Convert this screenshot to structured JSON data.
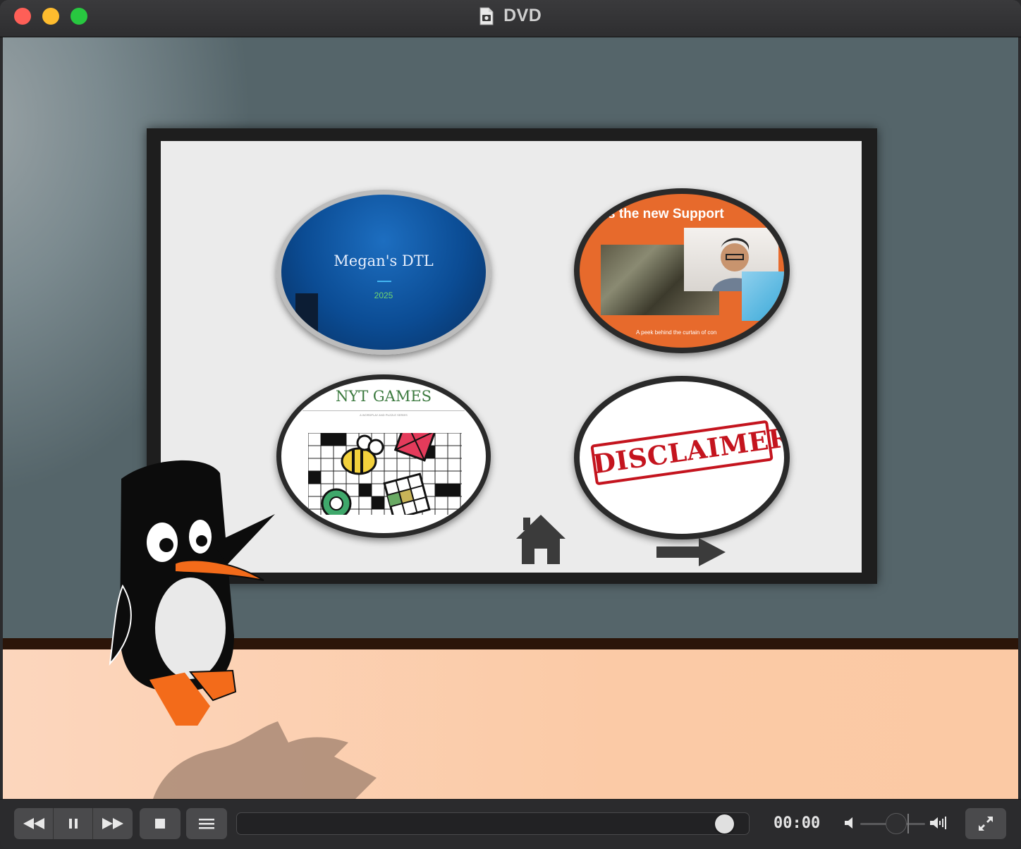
{
  "window": {
    "title": "DVD"
  },
  "menu": {
    "items": [
      {
        "label": "Megan's DTL",
        "year": "2025"
      },
      {
        "heading": "s the new Support",
        "caption": "A peek behind the curtain of con"
      },
      {
        "title": "NYT GAMES",
        "subtitle": "A WORDPLAY AND PUZZLE SERIES"
      },
      {
        "stamp": "DISCLAIMER"
      }
    ]
  },
  "controls": {
    "time": "00:00",
    "progress_fraction": 0.95,
    "volume_fraction": 0.55
  },
  "icons": {
    "rewind": "rewind-icon",
    "pause": "pause-icon",
    "fast_forward": "fast-forward-icon",
    "stop": "stop-icon",
    "playlist": "playlist-icon",
    "volume_low": "volume-low-icon",
    "volume_high": "volume-high-icon",
    "fullscreen": "fullscreen-icon",
    "home": "home-icon",
    "next": "next-arrow-icon"
  },
  "colors": {
    "close": "#fe5f57",
    "minimize": "#febc2e",
    "maximize": "#28c840",
    "wall": "#55656a",
    "floor": "#fbcaa6",
    "stamp_red": "#c4141e"
  }
}
